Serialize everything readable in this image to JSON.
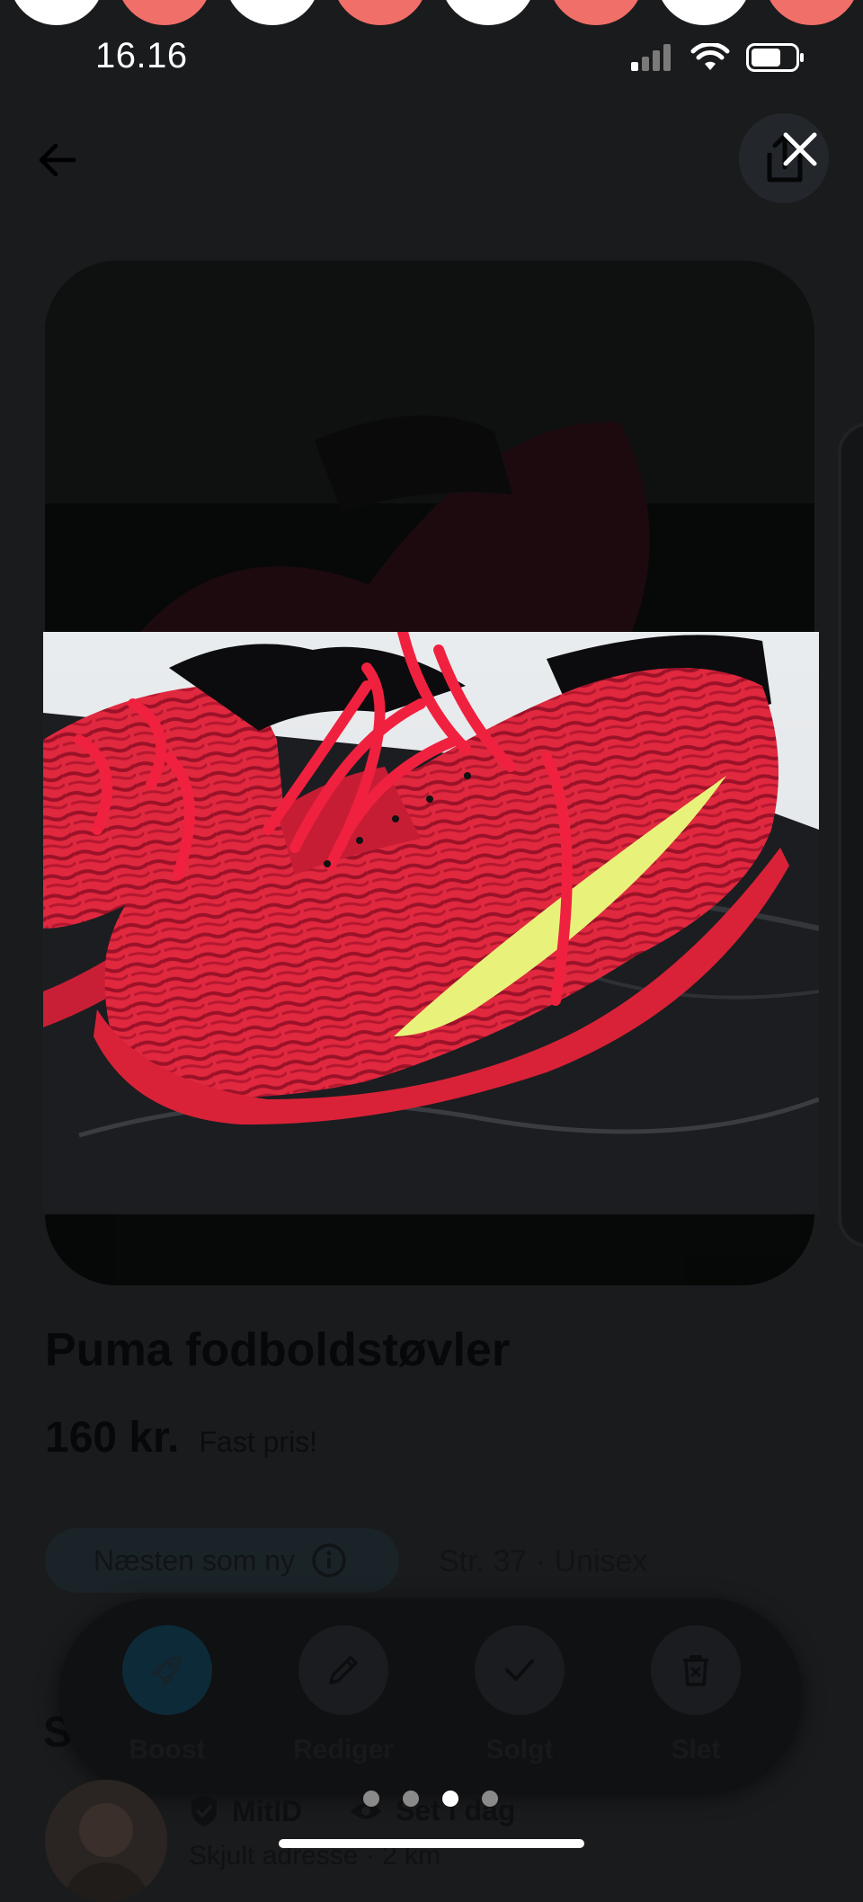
{
  "status_bar": {
    "time": "16.16"
  },
  "listing": {
    "title": "Puma fodboldstøvler",
    "price": "160 kr.",
    "price_note": "Fast pris!",
    "condition": "Næsten som ny",
    "size": "Str. 37 · Unisex"
  },
  "photo_viewer": {
    "page_count": 4,
    "active_page": 3
  },
  "actions": [
    {
      "label": "Boost",
      "icon": "rocket-icon"
    },
    {
      "label": "Rediger",
      "icon": "pencil-icon"
    },
    {
      "label": "Solgt",
      "icon": "check-icon"
    },
    {
      "label": "Slet",
      "icon": "trash-icon"
    }
  ],
  "section": {
    "partial_heading": "S"
  },
  "seller": {
    "verified_label": "MitID",
    "seen_label": "Set i dag",
    "address": "Skjult adresse · 2 km"
  },
  "colors": {
    "shoe": "#e0283f",
    "swoosh": "#e8f27a",
    "active_dot": "#ffffff",
    "inactive_dot": "#8a8a8a"
  }
}
